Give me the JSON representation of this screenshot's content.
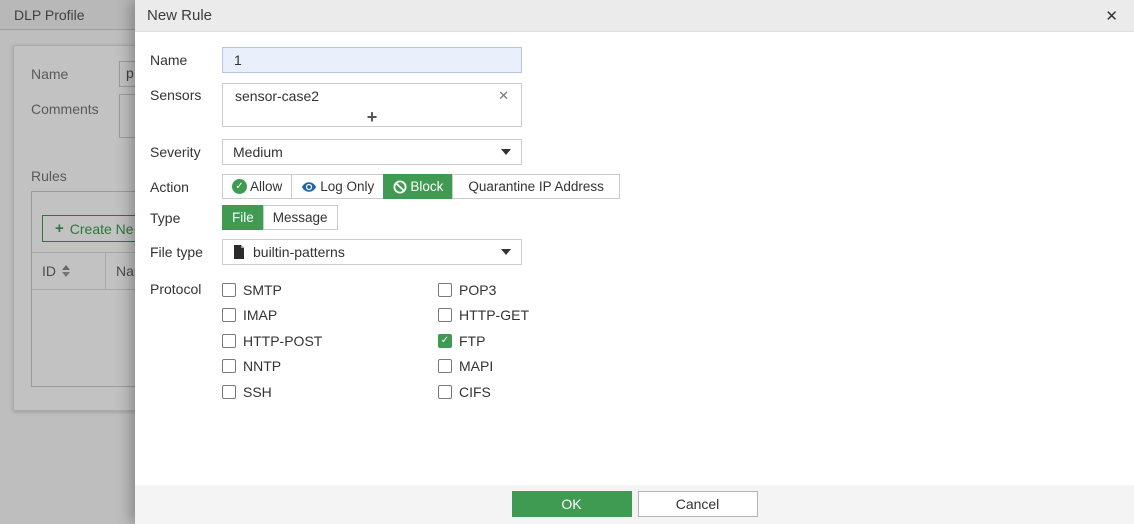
{
  "colors": {
    "accent_green": "#3f9b51",
    "eye_blue": "#1f64a8",
    "modal_header_bg": "#ebebeb",
    "footer_bg": "#f4f4f4",
    "focused_input_bg": "#e9effb"
  },
  "background": {
    "page_title": "DLP Profile",
    "profile_form": {
      "name_label": "Name",
      "name_value": "p",
      "comments_label": "Comments"
    },
    "rules_section": {
      "label": "Rules",
      "create_button_label": "Create Ne",
      "table": {
        "id_column": "ID",
        "name_column": "Nar"
      }
    }
  },
  "modal": {
    "title": "New Rule",
    "close_icon": "✕",
    "name": {
      "label": "Name",
      "value": "1"
    },
    "sensors": {
      "label": "Sensors",
      "entries": [
        {
          "name": "sensor-case2"
        }
      ],
      "remove_icon": "✕",
      "add_icon": "+"
    },
    "severity": {
      "label": "Severity",
      "value": "Medium"
    },
    "action": {
      "label": "Action",
      "options": [
        {
          "label": "Allow",
          "icon": "check-circle",
          "selected": false
        },
        {
          "label": "Log Only",
          "icon": "eye",
          "selected": false
        },
        {
          "label": "Block",
          "icon": "block",
          "selected": true
        },
        {
          "label": "Quarantine IP Address",
          "icon": "none",
          "selected": false
        }
      ]
    },
    "type": {
      "label": "Type",
      "options": [
        {
          "label": "File",
          "selected": true
        },
        {
          "label": "Message",
          "selected": false
        }
      ]
    },
    "file_type": {
      "label": "File type",
      "value": "builtin-patterns",
      "icon": "file"
    },
    "protocol": {
      "label": "Protocol",
      "items": [
        {
          "label": "SMTP",
          "checked": false
        },
        {
          "label": "IMAP",
          "checked": false
        },
        {
          "label": "HTTP-POST",
          "checked": false
        },
        {
          "label": "NNTP",
          "checked": false
        },
        {
          "label": "SSH",
          "checked": false
        },
        {
          "label": "POP3",
          "checked": false
        },
        {
          "label": "HTTP-GET",
          "checked": false
        },
        {
          "label": "FTP",
          "checked": true
        },
        {
          "label": "MAPI",
          "checked": false
        },
        {
          "label": "CIFS",
          "checked": false
        }
      ]
    },
    "footer": {
      "ok_label": "OK",
      "cancel_label": "Cancel"
    }
  }
}
